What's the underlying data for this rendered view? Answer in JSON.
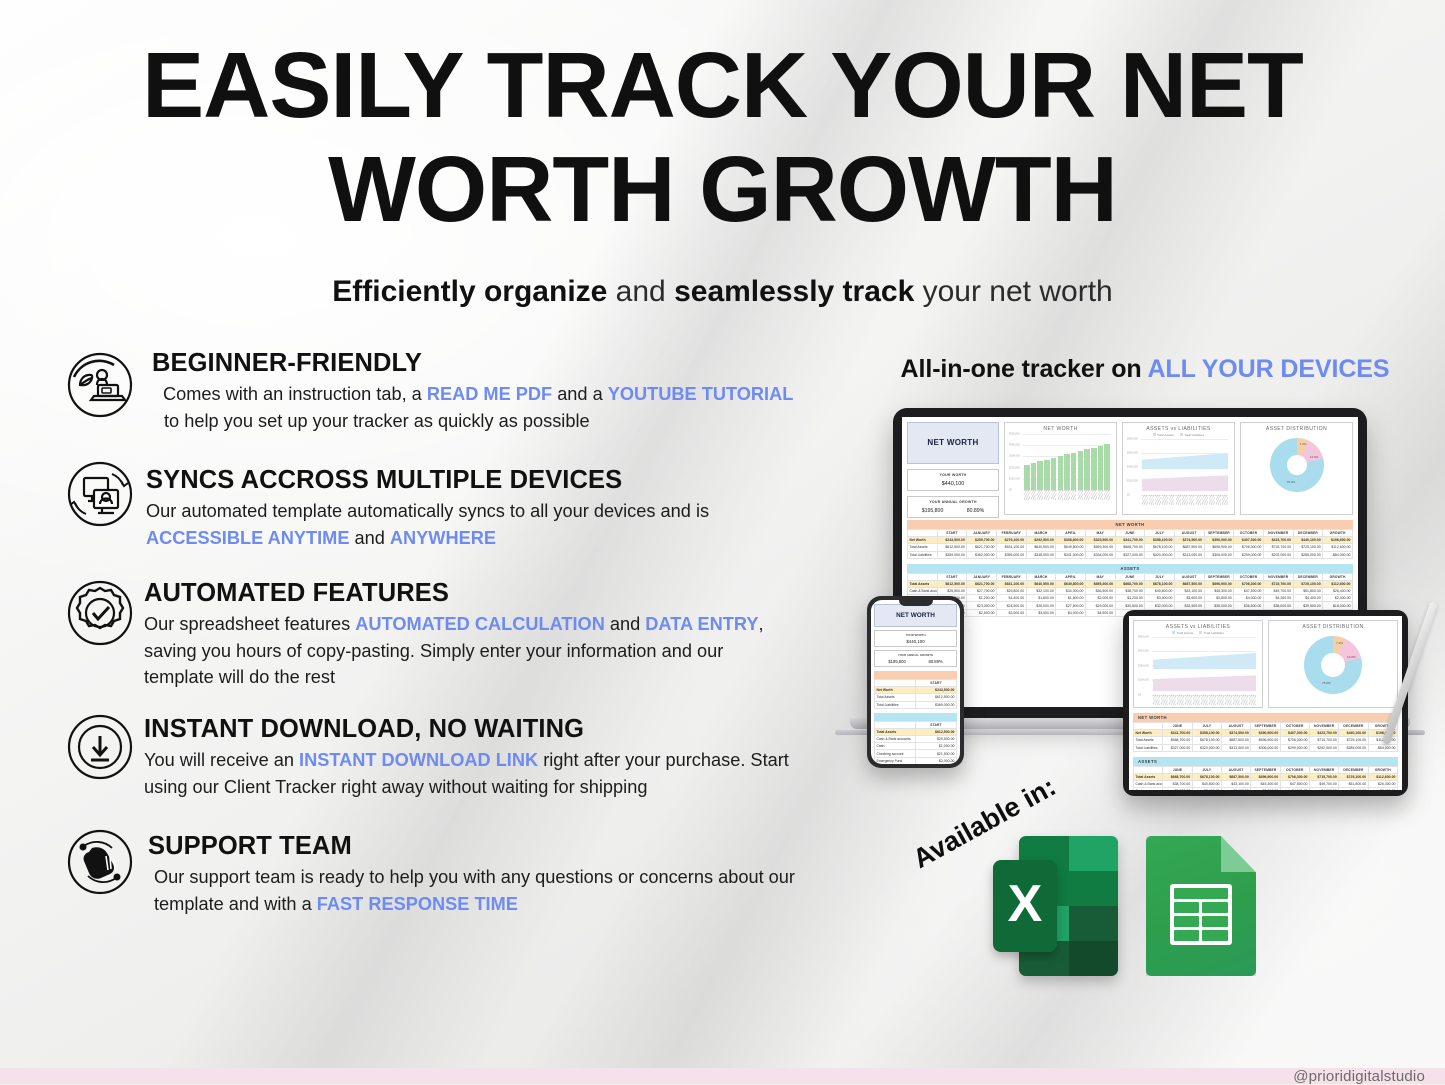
{
  "headline": {
    "line1": "EASILY TRACK YOUR NET",
    "line2": "WORTH GROWTH"
  },
  "subhead": {
    "b1": "Efficiently organize",
    "mid": " and ",
    "b2": "seamlessly track",
    "tail": " your net worth"
  },
  "features": [
    {
      "icon": "plant-laptop-icon",
      "title": "BEGINNER-FRIENDLY",
      "desc_parts": [
        {
          "t": "Comes with an instruction tab, a ",
          "hl": false
        },
        {
          "t": "READ ME PDF",
          "hl": true
        },
        {
          "t": " and a ",
          "hl": false
        },
        {
          "t": "YOUTUBE TUTORIAL",
          "hl": true
        },
        {
          "t": " to help you set up your tracker as quickly as possible",
          "hl": false
        }
      ]
    },
    {
      "icon": "sync-devices-icon",
      "title": "SYNCS ACCROSS MULTIPLE DEVICES",
      "desc_parts": [
        {
          "t": "Our automated template automatically syncs to all your devices and is ",
          "hl": false
        },
        {
          "t": "ACCESSIBLE ANYTIME",
          "hl": true
        },
        {
          "t": " and ",
          "hl": false
        },
        {
          "t": "ANYWHERE",
          "hl": true
        }
      ]
    },
    {
      "icon": "gear-check-icon",
      "title": "AUTOMATED FEATURES",
      "desc_parts": [
        {
          "t": "Our spreadsheet features ",
          "hl": false
        },
        {
          "t": "AUTOMATED CALCULATION",
          "hl": true
        },
        {
          "t": " and ",
          "hl": false
        },
        {
          "t": "DATA ENTRY",
          "hl": true
        },
        {
          "t": ", saving you hours of copy-pasting. Simply enter your information and our template will do the rest",
          "hl": false
        }
      ]
    },
    {
      "icon": "download-arrow-icon",
      "title": "INSTANT DOWNLOAD, NO WAITING",
      "desc_parts": [
        {
          "t": "You will receive an ",
          "hl": false
        },
        {
          "t": "INSTANT DOWNLOAD LINK",
          "hl": true
        },
        {
          "t": " right after your purchase. Start using our Client Tracker right away without waiting for shipping",
          "hl": false
        }
      ]
    },
    {
      "icon": "support-hand-icon",
      "title": "SUPPORT TEAM",
      "desc_parts": [
        {
          "t": "Our support team is ready to help you with any questions or concerns about our template and with a ",
          "hl": false
        },
        {
          "t": "FAST RESPONSE TIME",
          "hl": true
        }
      ]
    }
  ],
  "devices": {
    "heading_plain": "All-in-one tracker on ",
    "heading_accent": "ALL YOUR DEVICES"
  },
  "dashboard": {
    "kpi_main": "NET WORTH",
    "worth_label": "YOUR WORTH",
    "worth_value": "$440,100",
    "growth_label": "YOUR ANNUAL GROWTH",
    "growth_value": "$195,800",
    "growth_pct": "80.89%",
    "net_worth_band": "NET WORTH",
    "assets_band": "ASSETS",
    "months": [
      "START",
      "JANUARY",
      "FEBRUARY",
      "MARCH",
      "APRIL",
      "MAY",
      "JUNE",
      "JULY",
      "AUGUST",
      "SEPTEMBER",
      "OCTOBER",
      "NOVEMBER",
      "DECEMBER",
      "GROWTH"
    ],
    "nw_rows": [
      {
        "label": "Net Worth",
        "total": true,
        "cells": [
          "$243,500.00",
          "$259,700.00",
          "$276,100.00",
          "$292,500.00",
          "$308,600.00",
          "$325,500.00",
          "$341,700.00",
          "$358,100.00",
          "$374,500.00",
          "$390,900.00",
          "$407,300.00",
          "$423,700.00",
          "$440,100.00",
          "$196,600.00"
        ]
      },
      {
        "label": "Total Assets",
        "total": false,
        "cells": [
          "$612,500.00",
          "$621,700.00",
          "$631,100.00",
          "$640,500.00",
          "$649,800.00",
          "$659,300.00",
          "$668,700.00",
          "$678,100.00",
          "$687,500.00",
          "$696,900.00",
          "$706,300.00",
          "$715,700.00",
          "$725,100.00",
          "$112,600.00"
        ]
      },
      {
        "label": "Total Liabilities",
        "total": false,
        "cells": [
          "$369,000.00",
          "$362,000.00",
          "$355,000.00",
          "$348,000.00",
          "$341,000.00",
          "$334,000.00",
          "$327,000.00",
          "$320,000.00",
          "$313,000.00",
          "$306,000.00",
          "$299,000.00",
          "$292,000.00",
          "$285,000.00",
          "-$84,000.00"
        ]
      }
    ],
    "as_rows": [
      {
        "label": "Total Assets",
        "total": true,
        "cells": [
          "$612,500.00",
          "$621,700.00",
          "$631,100.00",
          "$640,500.00",
          "$649,800.00",
          "$659,300.00",
          "$668,700.00",
          "$678,100.00",
          "$687,500.00",
          "$696,900.00",
          "$706,300.00",
          "$715,700.00",
          "$725,100.00",
          "$112,600.00"
        ]
      },
      {
        "label": "Cash & Bank accounts",
        "total": false,
        "cells": [
          "$25,500.00",
          "$27,700.00",
          "$29,800.00",
          "$32,100.00",
          "$34,300.00",
          "$36,500.00",
          "$38,700.00",
          "$40,800.00",
          "$43,100.00",
          "$45,300.00",
          "$47,500.00",
          "$49,700.00",
          "$51,800.00",
          "$26,400.00"
        ]
      },
      {
        "label": "Cash",
        "total": false,
        "cells": [
          "$1,000.00",
          "$1,200.00",
          "$1,400.00",
          "$1,600.00",
          "$1,800.00",
          "$2,000.00",
          "$3,200.00",
          "$3,400.00",
          "$3,600.00",
          "$3,800.00",
          "$4,000.00",
          "$4,200.00",
          "$4,400.00",
          "$2,400.00"
        ]
      },
      {
        "label": "Checking account",
        "total": false,
        "cells": [
          "$21,500.00",
          "$23,000.00",
          "$24,500.00",
          "$26,000.00",
          "$27,500.00",
          "$29,000.00",
          "$30,500.00",
          "$32,000.00",
          "$33,500.00",
          "$35,000.00",
          "$36,500.00",
          "$38,000.00",
          "$39,500.00",
          "$18,000.00"
        ]
      },
      {
        "label": "Emergency Fund",
        "total": false,
        "cells": [
          "$2,000.00",
          "$2,500.00",
          "$3,000.00",
          "$3,500.00",
          "$4,000.00",
          "$4,500.00",
          "$5,000.00",
          "$5,500.00",
          "$6,000.00",
          "$6,500.00",
          "$7,000.00",
          "$7,500.00",
          "$8,000.00",
          "$6,000.00"
        ]
      }
    ]
  },
  "chart_data": [
    {
      "type": "bar",
      "title": "NET WORTH",
      "categories": [
        "START",
        "JANUARY",
        "FEBRUARY",
        "MARCH",
        "APRIL",
        "MAY",
        "JUNE",
        "JULY",
        "AUGUST",
        "SEPTEMBER",
        "OCTOBER",
        "NOVEMBER",
        "DECEMBER"
      ],
      "values": [
        243500,
        259700,
        276100,
        292500,
        308600,
        325500,
        341700,
        358100,
        374500,
        390900,
        407300,
        423700,
        440100
      ],
      "ytick_labels": [
        "$0",
        "$100,000",
        "$200,000",
        "$300,000",
        "$400,000",
        "$500,000"
      ],
      "ylim": [
        0,
        500000
      ],
      "xlabel": "",
      "ylabel": "",
      "series_color": "#a8dba8",
      "grid": true,
      "legend": "none"
    },
    {
      "type": "area",
      "title": "ASSETS vs LIABILITIES",
      "categories": [
        "START",
        "JANUARY",
        "FEBRUARY",
        "MARCH",
        "APRIL",
        "MAY",
        "JUNE",
        "JULY",
        "AUGUST",
        "SEPTEMBER",
        "OCTOBER",
        "NOVEMBER",
        "DECEMBER"
      ],
      "series": [
        {
          "name": "Total Assets",
          "color": "#bfe4f2",
          "values": [
            612500,
            621700,
            631100,
            640500,
            649800,
            659300,
            668700,
            678100,
            687500,
            696900,
            706300,
            715700,
            725100
          ]
        },
        {
          "name": "Total Liabilities",
          "color": "#e9d4e6",
          "values": [
            369000,
            362000,
            355000,
            348000,
            341000,
            334000,
            327000,
            320000,
            313000,
            306000,
            299000,
            292000,
            285000
          ]
        }
      ],
      "ytick_labels": [
        "$0",
        "$200,000",
        "$400,000",
        "$600,000",
        "$800,000"
      ],
      "ylim": [
        0,
        800000
      ],
      "grid": true,
      "legend": "top"
    },
    {
      "type": "pie",
      "title": "ASSET DISTRIBUTION",
      "labels": [
        "Cash & Bank accounts",
        "Investments",
        "Properties"
      ],
      "values": [
        7.2,
        14.0,
        75.0
      ],
      "value_labels": [
        "7.2%",
        "14.0%",
        "75.0%"
      ],
      "colors": [
        "#f7cfa6",
        "#f3c6dd",
        "#a9dcec"
      ],
      "legend": "callout"
    }
  ],
  "available": {
    "label": "Available in:",
    "logos": [
      "excel-logo",
      "google-sheets-logo"
    ],
    "excel_letter": "X"
  },
  "footer": {
    "watermark": "@prioridigitalstudio"
  },
  "colors": {
    "accent_blue": "#6d8bf2",
    "footer_pink": "#f5e1ea",
    "excel_green": "#107c41",
    "sheets_green": "#34a853"
  }
}
